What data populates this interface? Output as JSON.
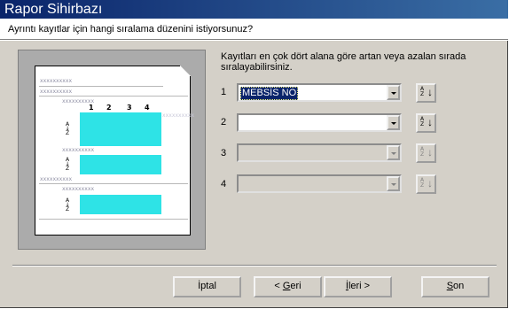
{
  "window": {
    "title": "Rapor Sihirbazı"
  },
  "question": "Ayrıntı kayıtlar için hangi sıralama düzenini istiyorsunuz?",
  "instructions": "Kayıtları en çok dört alana göre artan veya azalan sırada sıralayabilirsiniz.",
  "preview": {
    "placeholder": "xxxxxxxxxx",
    "column_numbers": [
      "1",
      "2",
      "3",
      "4"
    ],
    "sort_glyph_top": "A",
    "sort_glyph_bottom": "Z"
  },
  "sort_rows": [
    {
      "number": "1",
      "field": "MEBSİS NO",
      "enabled": true,
      "selected": true,
      "sort_label_top": "A",
      "sort_label_bottom": "Z"
    },
    {
      "number": "2",
      "field": "",
      "enabled": true,
      "selected": false,
      "sort_label_top": "A",
      "sort_label_bottom": "Z"
    },
    {
      "number": "3",
      "field": "",
      "enabled": false,
      "selected": false,
      "sort_label_top": "A",
      "sort_label_bottom": "Z"
    },
    {
      "number": "4",
      "field": "",
      "enabled": false,
      "selected": false,
      "sort_label_top": "A",
      "sort_label_bottom": "Z"
    }
  ],
  "buttons": {
    "cancel": "İptal",
    "back_pre": "< ",
    "back_ul": "G",
    "back_post": "eri",
    "next_ul": "İ",
    "next_post": "leri >",
    "finish_ul": "S",
    "finish_post": "on"
  }
}
